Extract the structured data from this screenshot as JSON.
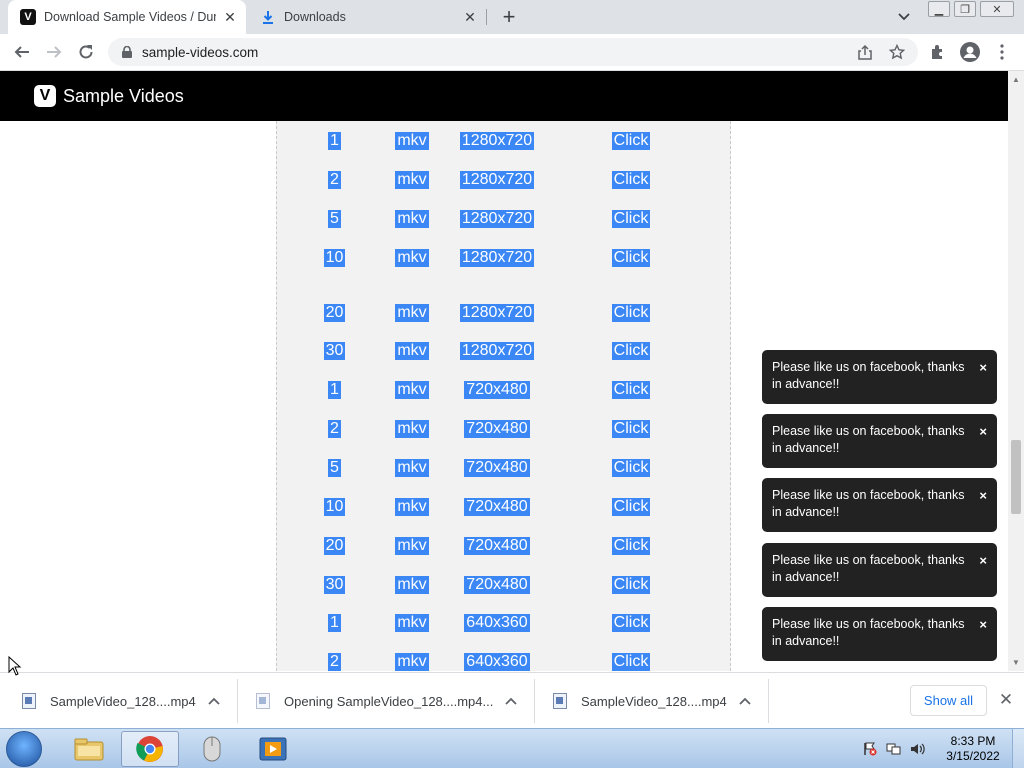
{
  "browser": {
    "tabs": [
      {
        "title": "Download Sample Videos / Dum",
        "favicon": "V",
        "active": true
      },
      {
        "title": "Downloads",
        "favicon": "download-icon",
        "active": false
      }
    ],
    "new_tab": "+",
    "url": "sample-videos.com"
  },
  "site": {
    "brand_letter": "V",
    "brand_name": "Sample Videos"
  },
  "table": {
    "rows": [
      {
        "size": "1",
        "format": "mkv",
        "resolution": "1280x720",
        "action": "Click"
      },
      {
        "size": "2",
        "format": "mkv",
        "resolution": "1280x720",
        "action": "Click"
      },
      {
        "size": "5",
        "format": "mkv",
        "resolution": "1280x720",
        "action": "Click"
      },
      {
        "size": "10",
        "format": "mkv",
        "resolution": "1280x720",
        "action": "Click"
      },
      {
        "size": "20",
        "format": "mkv",
        "resolution": "1280x720",
        "action": "Click"
      },
      {
        "size": "30",
        "format": "mkv",
        "resolution": "1280x720",
        "action": "Click"
      },
      {
        "size": "1",
        "format": "mkv",
        "resolution": "720x480",
        "action": "Click"
      },
      {
        "size": "2",
        "format": "mkv",
        "resolution": "720x480",
        "action": "Click"
      },
      {
        "size": "5",
        "format": "mkv",
        "resolution": "720x480",
        "action": "Click"
      },
      {
        "size": "10",
        "format": "mkv",
        "resolution": "720x480",
        "action": "Click"
      },
      {
        "size": "20",
        "format": "mkv",
        "resolution": "720x480",
        "action": "Click"
      },
      {
        "size": "30",
        "format": "mkv",
        "resolution": "720x480",
        "action": "Click"
      },
      {
        "size": "1",
        "format": "mkv",
        "resolution": "640x360",
        "action": "Click"
      },
      {
        "size": "2",
        "format": "mkv",
        "resolution": "640x360",
        "action": "Click"
      }
    ]
  },
  "toasts": [
    {
      "message": "Please like us on facebook, thanks in advance!!",
      "close": "×"
    },
    {
      "message": "Please like us on facebook, thanks in advance!!",
      "close": "×"
    },
    {
      "message": "Please like us on facebook, thanks in advance!!",
      "close": "×"
    },
    {
      "message": "Please like us on facebook, thanks in advance!!",
      "close": "×"
    },
    {
      "message": "Please like us on facebook, thanks in advance!!",
      "close": "×"
    }
  ],
  "downloads": {
    "items": [
      {
        "name": "SampleVideo_128....mp4"
      },
      {
        "name": "Opening SampleVideo_128....mp4..."
      },
      {
        "name": "SampleVideo_128....mp4"
      }
    ],
    "show_all": "Show all",
    "close": "✕"
  },
  "taskbar": {
    "time": "8:33 PM",
    "date": "3/15/2022"
  },
  "colors": {
    "selection": "#3a87f5",
    "header_bg": "#000000",
    "toast_bg": "#222222",
    "link": "#1a73e8"
  }
}
